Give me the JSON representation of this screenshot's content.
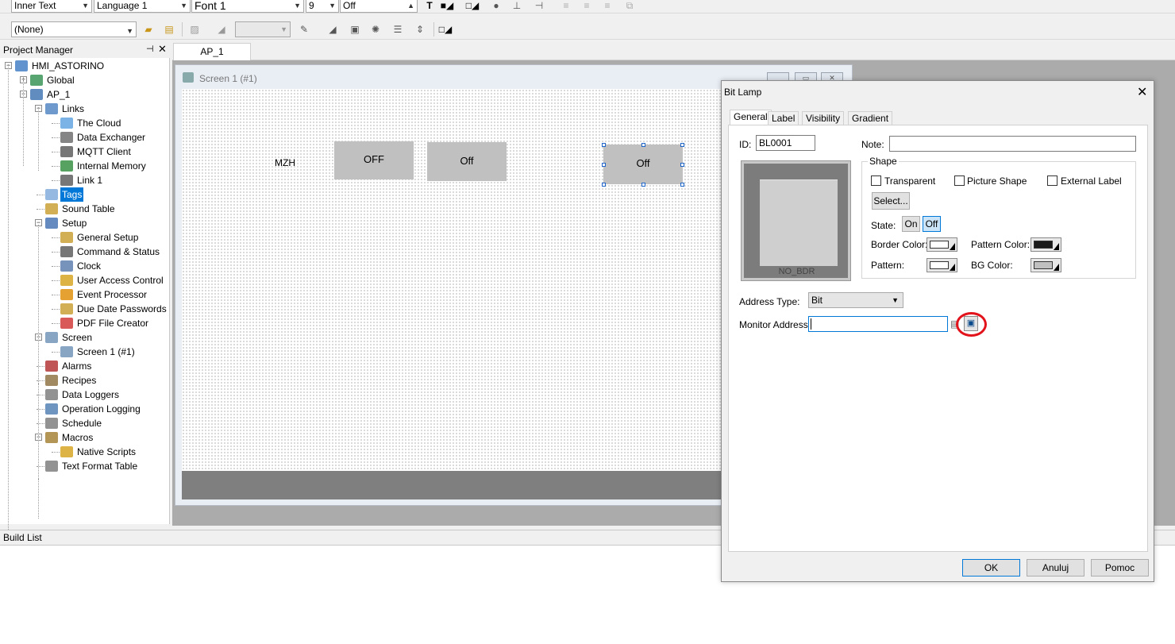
{
  "toolbar1": {
    "text_mode": "Inner Text",
    "language": "Language 1",
    "font": "Font 1",
    "font_size": "9",
    "state_text": "Off"
  },
  "toolbar2": {
    "style": "(None)"
  },
  "project_manager": {
    "title": "Project Manager",
    "pin_icon": "pin-icon",
    "close_symbol": "✕",
    "tree": [
      {
        "label": "HMI_ASTORINO",
        "icon": "project-icon"
      },
      {
        "label": "Global",
        "icon": "global-icon"
      },
      {
        "label": "AP_1",
        "icon": "computer-icon"
      },
      {
        "label": "Links",
        "icon": "links-icon"
      },
      {
        "label": "The Cloud",
        "icon": "cloud-icon"
      },
      {
        "label": "Data Exchanger",
        "icon": "data-exchanger-icon"
      },
      {
        "label": "MQTT Client",
        "icon": "mqtt-icon"
      },
      {
        "label": "Internal Memory",
        "icon": "memory-icon"
      },
      {
        "label": "Link 1",
        "icon": "link-icon"
      },
      {
        "label": "Tags",
        "icon": "tags-icon"
      },
      {
        "label": "Sound Table",
        "icon": "sound-icon"
      },
      {
        "label": "Setup",
        "icon": "setup-icon"
      },
      {
        "label": "General Setup",
        "icon": "general-setup-icon"
      },
      {
        "label": "Command & Status",
        "icon": "command-icon"
      },
      {
        "label": "Clock",
        "icon": "clock-icon"
      },
      {
        "label": "User Access Control",
        "icon": "user-access-icon"
      },
      {
        "label": "Event Processor",
        "icon": "event-icon"
      },
      {
        "label": "Due Date Passwords",
        "icon": "password-icon"
      },
      {
        "label": "PDF File Creator",
        "icon": "pdf-icon"
      },
      {
        "label": "Screen",
        "icon": "screen-icon"
      },
      {
        "label": "Screen 1 (#1)",
        "icon": "screen-page-icon"
      },
      {
        "label": "Alarms",
        "icon": "alarm-icon"
      },
      {
        "label": "Recipes",
        "icon": "recipes-icon"
      },
      {
        "label": "Data Loggers",
        "icon": "data-logger-icon"
      },
      {
        "label": "Operation Logging",
        "icon": "operation-log-icon"
      },
      {
        "label": "Schedule",
        "icon": "schedule-icon"
      },
      {
        "label": "Macros",
        "icon": "macros-icon"
      },
      {
        "label": "Native Scripts",
        "icon": "scripts-icon"
      },
      {
        "label": "Text Format Table",
        "icon": "text-format-icon"
      }
    ]
  },
  "workspace": {
    "doc_tab": "AP_1",
    "screen_title": "Screen 1 (#1)",
    "canvas_items": {
      "label": "MZH",
      "btn1": "OFF",
      "btn2": "Off",
      "btn3": "Off"
    }
  },
  "build_list": {
    "title": "Build List"
  },
  "dialog": {
    "title": "Bit Lamp",
    "close": "✕",
    "tabs": [
      "General",
      "Label",
      "Visibility",
      "Gradient"
    ],
    "id_label": "ID:",
    "id_value": "BL0001",
    "note_label": "Note:",
    "note_value": "",
    "preview_label": "NO_BDR",
    "shape_group": "Shape",
    "transparent": "Transparent",
    "picture_shape": "Picture Shape",
    "external_label": "External Label",
    "select_btn": "Select...",
    "state_label": "State:",
    "state_on": "On",
    "state_off": "Off",
    "border_color": "Border Color:",
    "pattern_color": "Pattern Color:",
    "pattern": "Pattern:",
    "bg_color": "BG Color:",
    "address_type_label": "Address Type:",
    "address_type_value": "Bit",
    "monitor_address_label": "Monitor Address:",
    "monitor_address_value": "",
    "ok": "OK",
    "cancel": "Anuluj",
    "help": "Pomoc",
    "colors": {
      "border_swatch": "#ffffff",
      "pattern_color_swatch": "#1a1a1a",
      "pattern_swatch": "#ffffff",
      "bg_swatch": "#c0c0c0",
      "highlight_circle": "#e3131b",
      "selection_blue": "#0078d7"
    }
  }
}
